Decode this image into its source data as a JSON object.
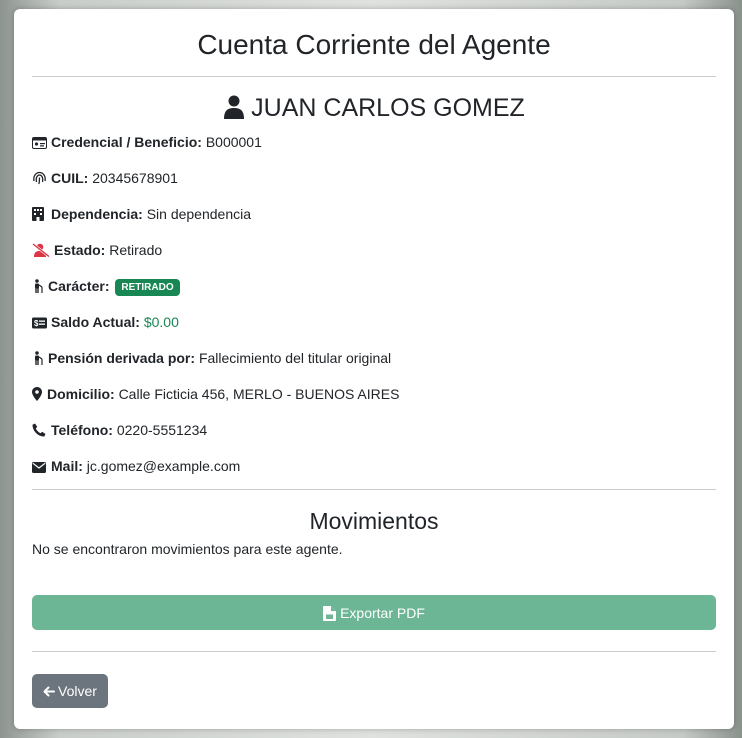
{
  "page": {
    "title": "Cuenta Corriente del Agente"
  },
  "agent": {
    "name": "JUAN CARLOS GOMEZ"
  },
  "fields": {
    "credencial": {
      "label": "Credencial / Beneficio:",
      "value": "B000001"
    },
    "cuil": {
      "label": "CUIL:",
      "value": "20345678901"
    },
    "dependencia": {
      "label": "Dependencia:",
      "value": "Sin dependencia"
    },
    "estado": {
      "label": "Estado:",
      "value": "Retirado"
    },
    "caracter": {
      "label": "Carácter:",
      "badge": "RETIRADO"
    },
    "saldo": {
      "label": "Saldo Actual:",
      "value": "$0.00"
    },
    "pension": {
      "label": "Pensión derivada por:",
      "value": "Fallecimiento del titular original"
    },
    "domicilio": {
      "label": "Domicilio:",
      "value": "Calle Ficticia 456, MERLO - BUENOS AIRES"
    },
    "telefono": {
      "label": "Teléfono:",
      "value": "0220-5551234"
    },
    "mail": {
      "label": "Mail:",
      "value": "jc.gomez@example.com"
    }
  },
  "movimientos": {
    "title": "Movimientos",
    "empty": "No se encontraron movimientos para este agente."
  },
  "buttons": {
    "export": "Exportar PDF",
    "back": "Volver"
  },
  "colors": {
    "badge": "#198754",
    "balance": "#198754",
    "export": "#6cb595",
    "back": "#6c757d",
    "estado_icon": "#dc3545"
  }
}
